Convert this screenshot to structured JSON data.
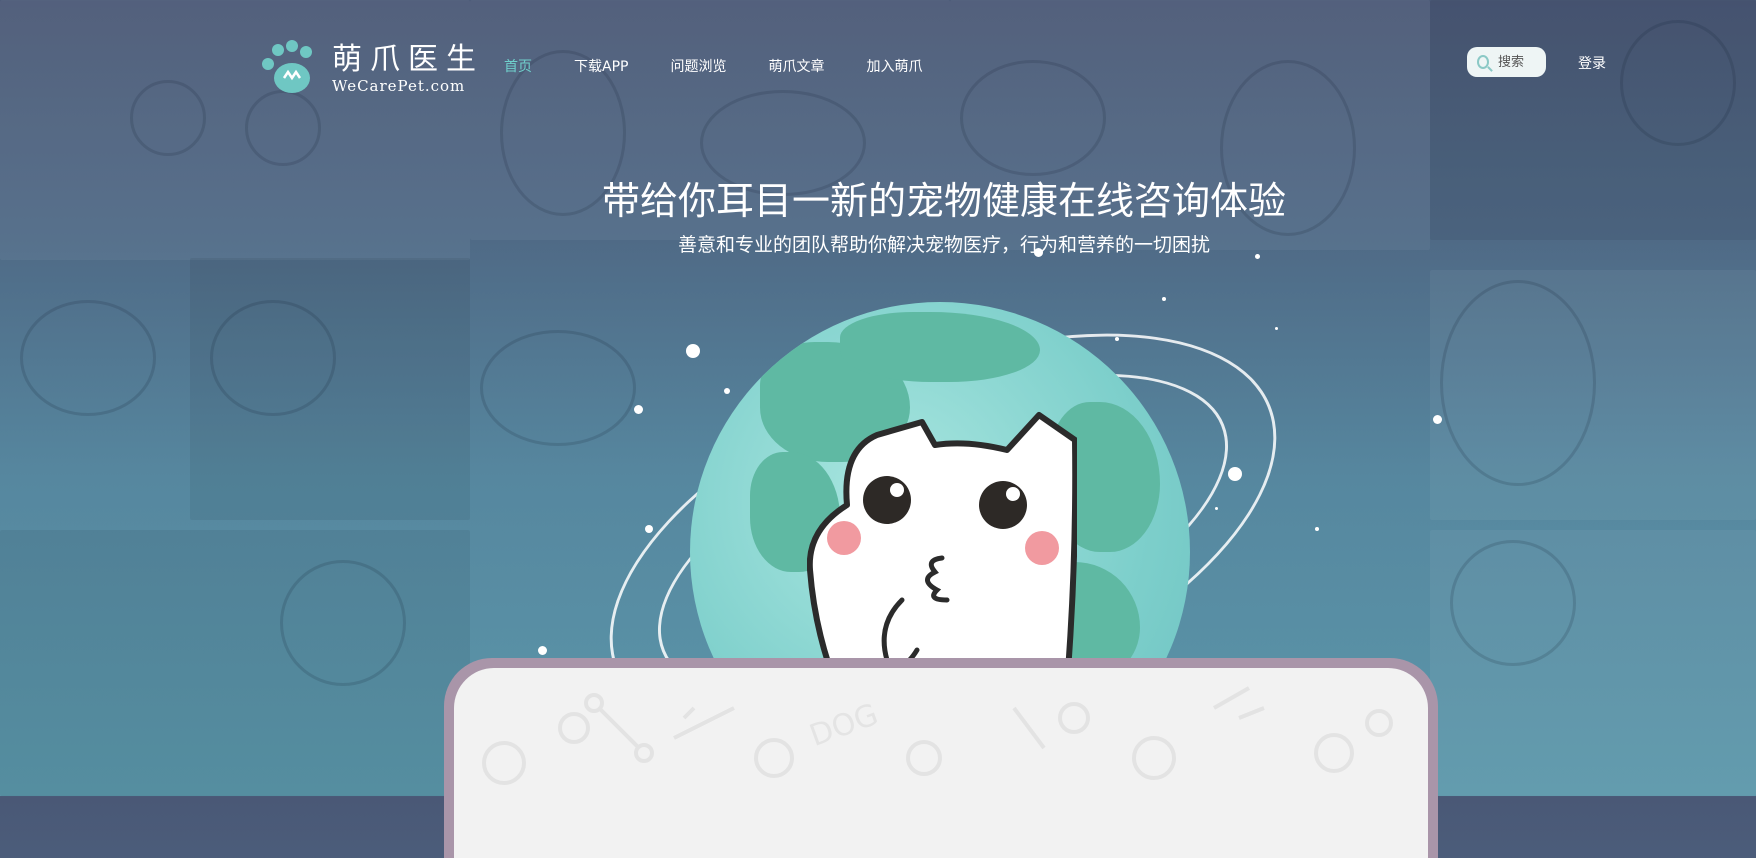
{
  "brand": {
    "name_cn": "萌爪医生",
    "name_en": "WeCarePet.com",
    "logo_icon": "paw-icon",
    "accent_color": "#6fd0cc"
  },
  "nav": {
    "items": [
      {
        "label": "首页",
        "active": true
      },
      {
        "label": "下载APP",
        "active": false
      },
      {
        "label": "问题浏览",
        "active": false
      },
      {
        "label": "萌爪文章",
        "active": false
      },
      {
        "label": "加入萌爪",
        "active": false
      }
    ]
  },
  "search": {
    "placeholder": "搜索",
    "icon": "search-icon"
  },
  "login_label": "登录",
  "hero": {
    "headline": "带给你耳目一新的宠物健康在线咨询体验",
    "subline": "善意和专业的团队帮助你解决宠物医疗，行为和营养的一切困扰"
  },
  "card": {
    "doodle_text": "DOG"
  }
}
